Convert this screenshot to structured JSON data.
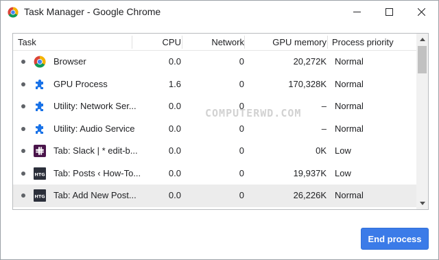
{
  "window": {
    "title": "Task Manager - Google Chrome",
    "app_icon": "chrome-icon",
    "controls": [
      "minimize-icon",
      "maximize-icon",
      "close-icon"
    ]
  },
  "table": {
    "headers": {
      "task": "Task",
      "cpu": "CPU",
      "network": "Network",
      "gpu_memory": "GPU memory",
      "priority": "Process priority"
    },
    "rows": [
      {
        "icon": "chrome-icon",
        "task": "Browser",
        "cpu": "0.0",
        "network": "0",
        "gpu_memory": "20,272K",
        "priority": "Normal",
        "selected": false
      },
      {
        "icon": "puzzle-icon",
        "task": "GPU Process",
        "cpu": "1.6",
        "network": "0",
        "gpu_memory": "170,328K",
        "priority": "Normal",
        "selected": false
      },
      {
        "icon": "puzzle-icon",
        "task": "Utility: Network Ser...",
        "cpu": "0.0",
        "network": "0",
        "gpu_memory": "–",
        "priority": "Normal",
        "selected": false
      },
      {
        "icon": "puzzle-icon",
        "task": "Utility: Audio Service",
        "cpu": "0.0",
        "network": "0",
        "gpu_memory": "–",
        "priority": "Normal",
        "selected": false
      },
      {
        "icon": "slack-icon",
        "task": "Tab: Slack | * edit-b...",
        "cpu": "0.0",
        "network": "0",
        "gpu_memory": "0K",
        "priority": "Low",
        "selected": false
      },
      {
        "icon": "htg-icon",
        "task": "Tab: Posts ‹ How-To...",
        "cpu": "0.0",
        "network": "0",
        "gpu_memory": "19,937K",
        "priority": "Low",
        "selected": false
      },
      {
        "icon": "htg-icon",
        "task": "Tab: Add New Post...",
        "cpu": "0.0",
        "network": "0",
        "gpu_memory": "26,226K",
        "priority": "Normal",
        "selected": true
      }
    ]
  },
  "watermark": "COMPUTERWD.COM",
  "end_button": {
    "label": "End process"
  },
  "colors": {
    "accent": "#3b7be8",
    "selected_row": "#ececec",
    "puzzle_icon": "#1a73e8",
    "htg_icon": "#2b2f3a"
  }
}
